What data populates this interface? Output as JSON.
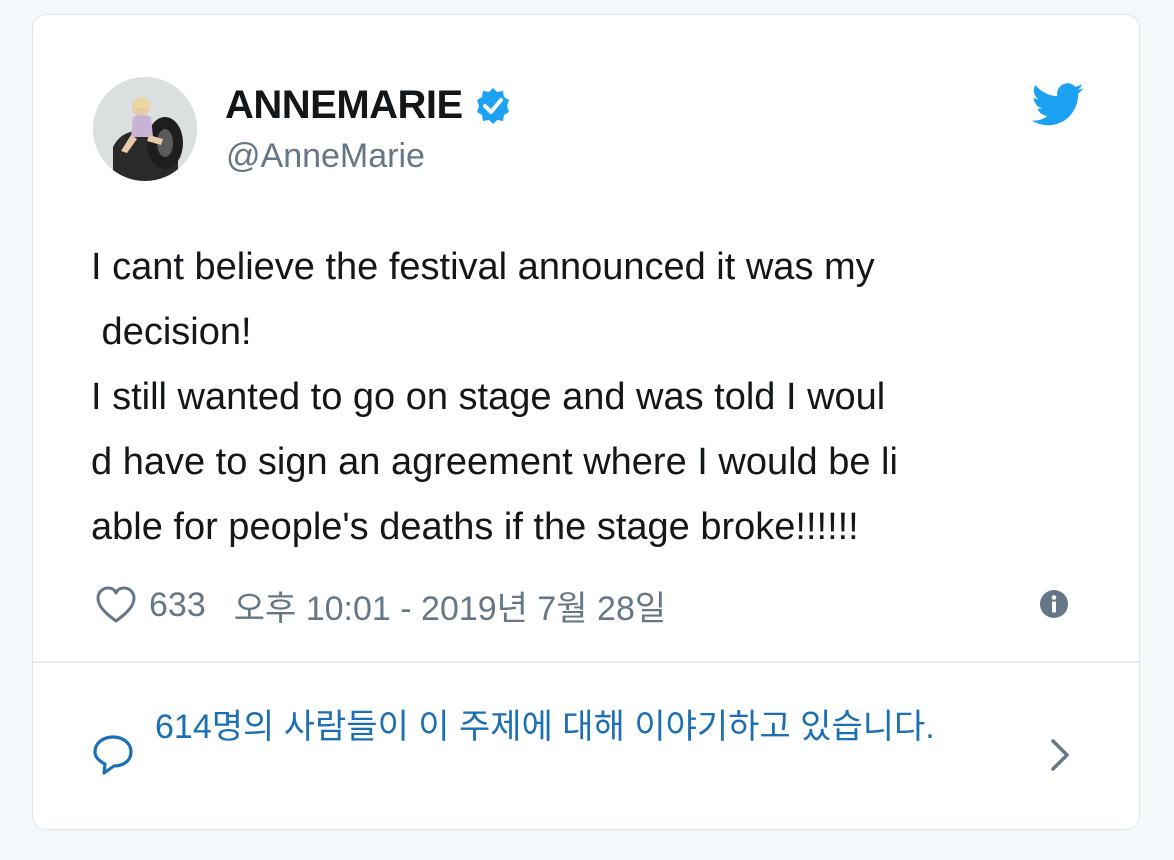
{
  "tweet": {
    "author": {
      "display_name": "ANNEMARIE",
      "handle": "@AnneMarie",
      "verified": true,
      "avatar": "profile-photo"
    },
    "text_lines": [
      "I cant believe the festival announced it was my",
      " decision!",
      "I still wanted to go on stage and was told I woul",
      "d have to sign an agreement where I would be li",
      "able for people's deaths if the stage broke!!!!!!"
    ],
    "likes": "633",
    "timestamp": "오후 10:01 - 2019년 7월 28일",
    "conversation": "614명의 사람들이 이 주제에 대해 이야기하고 있습니다."
  },
  "icons": {
    "brand": "twitter-bird-icon",
    "verified": "verified-badge-icon",
    "like": "heart-icon",
    "info": "info-icon",
    "conversation": "speech-bubble-icon",
    "chevron": "chevron-right-icon"
  },
  "colors": {
    "brand_blue": "#1da1f2",
    "link_blue": "#1b6fb5",
    "text": "#14171a",
    "muted": "#657786"
  }
}
